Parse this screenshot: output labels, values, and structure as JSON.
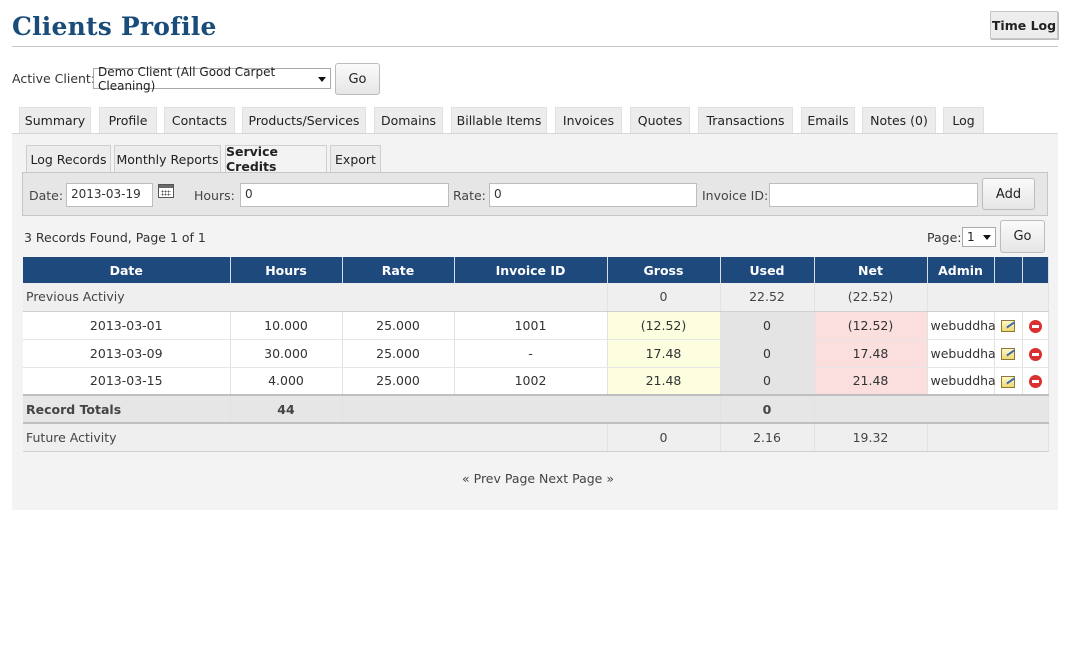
{
  "page": {
    "title": "Clients Profile",
    "time_log_label": "Time Log"
  },
  "client_picker": {
    "label": "Active Client:",
    "selected": "Demo Client (All Good Carpet Cleaning)",
    "go_label": "Go"
  },
  "tabs": [
    "Summary",
    "Profile",
    "Contacts",
    "Products/Services",
    "Domains",
    "Billable Items",
    "Invoices",
    "Quotes",
    "Transactions",
    "Emails",
    "Notes (0)",
    "Log"
  ],
  "subtabs": [
    "Log Records",
    "Monthly Reports",
    "Service Credits",
    "Export"
  ],
  "active_subtab": "Service Credits",
  "filter": {
    "date_label": "Date:",
    "date_value": "2013-03-19",
    "hours_label": "Hours:",
    "hours_value": "0",
    "rate_label": "Rate:",
    "rate_value": "0",
    "invoice_label": "Invoice ID:",
    "invoice_value": "",
    "add_label": "Add"
  },
  "results": {
    "summary": "3 Records Found, Page 1 of 1",
    "page_label": "Page:",
    "page_value": "1",
    "go_label": "Go"
  },
  "table": {
    "headers": [
      "Date",
      "Hours",
      "Rate",
      "Invoice ID",
      "Gross",
      "Used",
      "Net",
      "Admin"
    ],
    "previous": {
      "label": "Previous Activiy",
      "gross": "0",
      "used": "22.52",
      "net": "(22.52)"
    },
    "rows": [
      {
        "date": "2013-03-01",
        "hours": "10.000",
        "rate": "25.000",
        "invoice": "1001",
        "gross": "(12.52)",
        "used": "0",
        "net": "(12.52)",
        "admin": "webuddha"
      },
      {
        "date": "2013-03-09",
        "hours": "30.000",
        "rate": "25.000",
        "invoice": "-",
        "gross": "17.48",
        "used": "0",
        "net": "17.48",
        "admin": "webuddha"
      },
      {
        "date": "2013-03-15",
        "hours": "4.000",
        "rate": "25.000",
        "invoice": "1002",
        "gross": "21.48",
        "used": "0",
        "net": "21.48",
        "admin": "webuddha"
      }
    ],
    "totals": {
      "label": "Record Totals",
      "hours": "44",
      "used": "0"
    },
    "future": {
      "label": "Future Activity",
      "gross": "0",
      "used": "2.16",
      "net": "19.32"
    }
  },
  "pager": {
    "prev": "« Prev Page",
    "next": "Next Page »"
  },
  "colors": {
    "header_bg": "#1e497c",
    "title": "#1a4c7a",
    "negative": "#c00000",
    "gross_bg": "#fdfde0",
    "net_bg": "#fbdede"
  }
}
